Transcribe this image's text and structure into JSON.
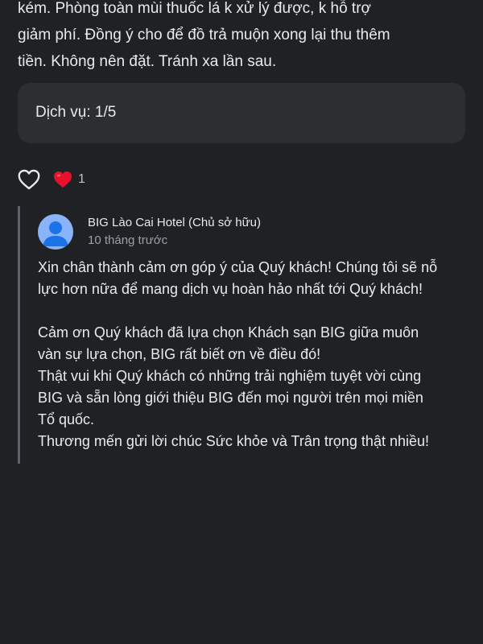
{
  "review": {
    "text_lines": [
      "kém. Phòng toàn mùi thuốc lá k xử lý được, k hỗ trợ",
      "giảm phí. Đồng ý cho để đồ trả muộn xong lại thu thêm",
      "tiền. Không nên đặt. Tránh xa lần sau."
    ],
    "rating_label": "Dịch vụ: 1/5"
  },
  "reactions": {
    "like_icon": "heart-outline-icon",
    "reaction_icon": "red-heart-icon",
    "count": "1",
    "accent_color": "#e8112d"
  },
  "owner_reply": {
    "name": "BIG Lào Cai Hotel (Chủ sở hữu)",
    "time": "10 tháng trước",
    "paragraph1": [
      "Xin chân thành cảm ơn góp ý của Quý khách! Chúng tôi sẽ nỗ",
      "lực hơn nữa để mang dịch vụ hoàn hảo nhất tới Quý khách!"
    ],
    "paragraph2": [
      "Cảm ơn Quý khách đã lựa chọn Khách sạn BIG giữa muôn",
      "vàn sự lựa chọn, BIG rất biết ơn về điều đó!",
      "Thật vui khi Quý khách có những trải nghiệm tuyệt vời cùng",
      "BIG và sẵn lòng giới thiệu BIG đến mọi người trên mọi miền",
      "Tổ quốc.",
      "Thương mến gửi lời chúc Sức khỏe và Trân trọng thật nhiều!"
    ]
  }
}
